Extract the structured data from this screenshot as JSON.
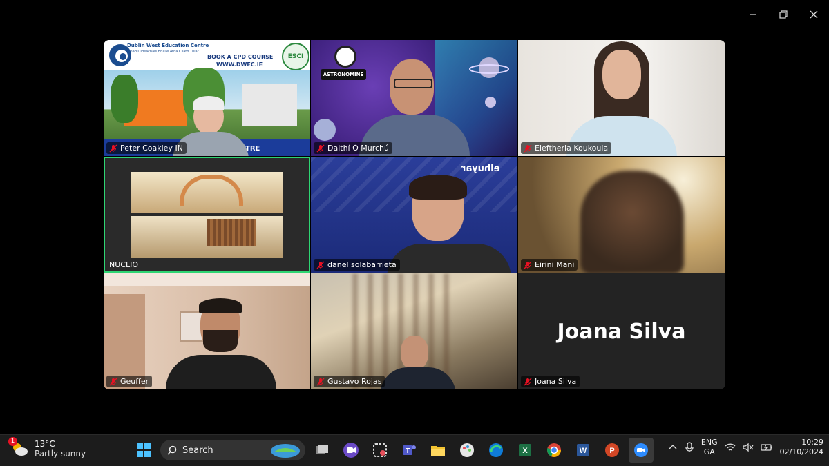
{
  "window_controls": {
    "minimize": "minimize",
    "restore": "restore",
    "close": "close"
  },
  "tiles": [
    {
      "name": "Peter Coakley",
      "overlay": "Peter Coakley IN",
      "banner_title": "Dublin West Education Centre",
      "banner_sub": "Ionad Oideachais Bhaile Átha Cliath Thiar",
      "banner_cta": "BOOK A CPD COURSE",
      "banner_url": "WWW.DWEC.IE",
      "banner_logo": "ESCI",
      "banner_tail": "TRE"
    },
    {
      "name": "Daithí Ó Murchú",
      "logo": "ASTRONOMINE"
    },
    {
      "name": "Eleftheria Koukoula"
    },
    {
      "name": "NUCLIO"
    },
    {
      "name": "danel solabarrieta",
      "logo": "elhuyar"
    },
    {
      "name": "Eirini Mani"
    },
    {
      "name": "Geuffer"
    },
    {
      "name": "Gustavo Rojas"
    },
    {
      "name": "Joana Silva",
      "big_name": "Joana Silva"
    }
  ],
  "taskbar": {
    "weather": {
      "temp": "13°C",
      "desc": "Partly sunny",
      "badge": "1"
    },
    "search_label": "Search",
    "lang": {
      "line1": "ENG",
      "line2": "GA"
    },
    "clock": {
      "time": "10:29",
      "date": "02/10/2024"
    }
  },
  "colors": {
    "active_border": "#2ed573",
    "muted_mic": "#e81123"
  }
}
